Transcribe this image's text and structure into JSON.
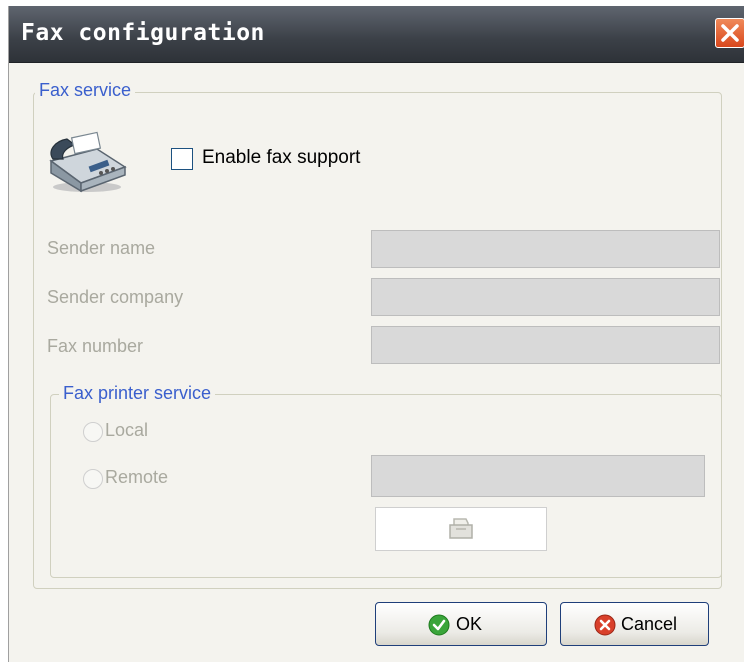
{
  "window": {
    "title": "Fax configuration"
  },
  "fax_service": {
    "legend": "Fax service",
    "enable_label": "Enable fax support",
    "enable_checked": false,
    "fields": [
      {
        "label": "Sender name",
        "value": ""
      },
      {
        "label": "Sender company",
        "value": ""
      },
      {
        "label": "Fax number",
        "value": ""
      }
    ]
  },
  "printer_service": {
    "legend": "Fax printer service",
    "local_label": "Local",
    "remote_label": "Remote",
    "remote_value": ""
  },
  "buttons": {
    "ok_label": "OK",
    "cancel_label": "Cancel"
  },
  "colors": {
    "legend_text": "#3a5fcd",
    "disabled_text": "#a9a99f",
    "ok_icon": "#3aa53a",
    "cancel_icon": "#d9402b"
  }
}
